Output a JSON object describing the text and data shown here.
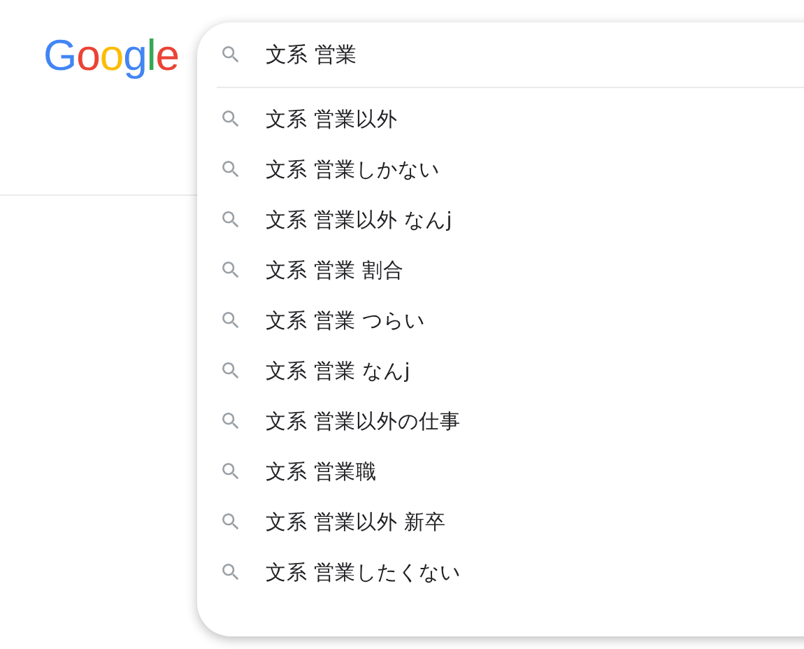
{
  "logo": {
    "letters": [
      {
        "char": "G",
        "color": "#4285f4"
      },
      {
        "char": "o",
        "color": "#ea4335"
      },
      {
        "char": "o",
        "color": "#fbbc05"
      },
      {
        "char": "g",
        "color": "#4285f4"
      },
      {
        "char": "l",
        "color": "#34a853"
      },
      {
        "char": "e",
        "color": "#ea4335"
      }
    ]
  },
  "search": {
    "value": "文系 営業"
  },
  "suggestions": [
    "文系 営業以外",
    "文系 営業しかない",
    "文系 営業以外 なんj",
    "文系 営業 割合",
    "文系 営業 つらい",
    "文系 営業 なんj",
    "文系 営業以外の仕事",
    "文系 営業職",
    "文系 営業以外 新卒",
    "文系 営業したくない"
  ]
}
